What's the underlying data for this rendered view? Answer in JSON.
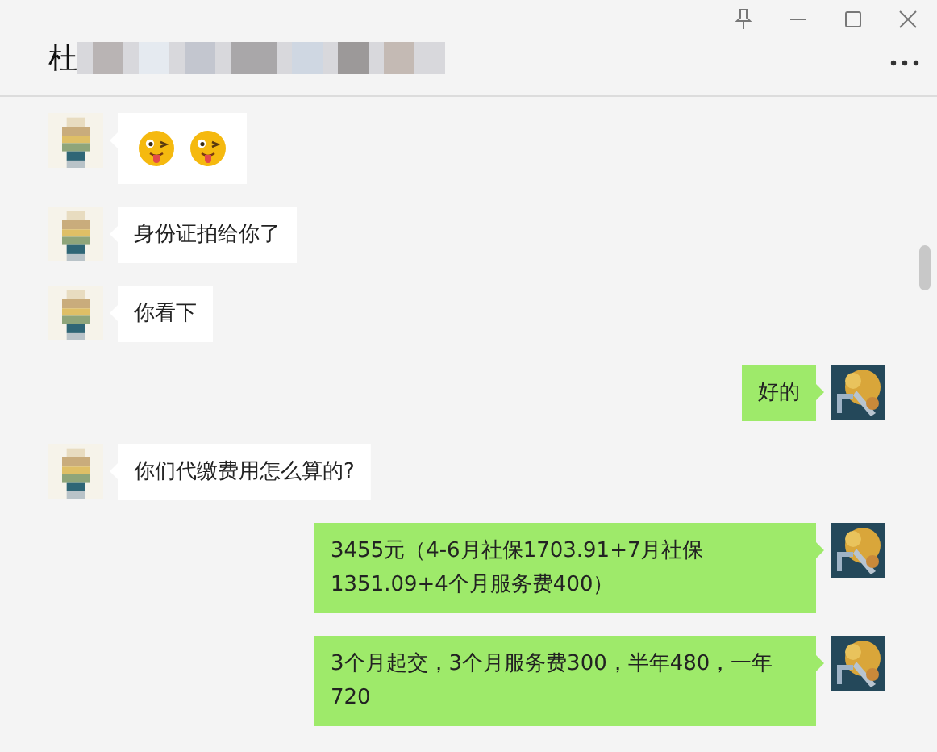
{
  "window": {
    "title": "杜"
  },
  "messages": [
    {
      "kind": "received",
      "emojis": [
        {
          "kind": "wink-tongue"
        },
        {
          "kind": "wink-tongue"
        }
      ]
    },
    {
      "kind": "received",
      "text": "身份证拍给你了"
    },
    {
      "kind": "received",
      "text": "你看下"
    },
    {
      "kind": "sent",
      "text": "好的"
    },
    {
      "kind": "received",
      "text": "你们代缴费用怎么算的?"
    },
    {
      "kind": "sent",
      "text": "3455元（4-6月社保1703.91+7月社保1351.09+4个月服务费400）"
    },
    {
      "kind": "sent",
      "text": "3个月起交，3个月服务费300，半年480，一年720"
    }
  ]
}
